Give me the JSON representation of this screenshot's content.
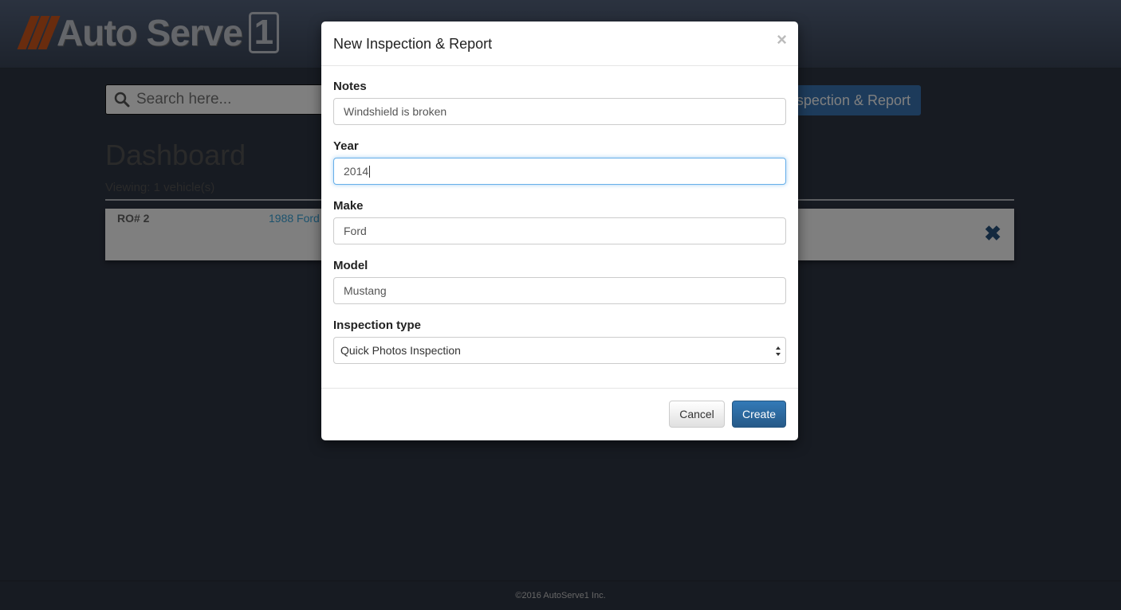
{
  "app": {
    "logo_text": "Auto Serve",
    "logo_number": "1"
  },
  "search": {
    "placeholder": "Search here..."
  },
  "header": {
    "new_report_label": "New Inspection & Report"
  },
  "dashboard": {
    "title": "Dashboard",
    "viewing_text": "Viewing: 1 vehicle(s)",
    "vehicles": [
      {
        "ro": "RO# 2",
        "name": "1988 Ford"
      }
    ]
  },
  "footer": {
    "text": "©2016 AutoServe1 Inc."
  },
  "modal": {
    "title": "New Inspection & Report",
    "close_symbol": "×",
    "fields": {
      "notes": {
        "label": "Notes",
        "value": "Windshield is broken"
      },
      "year": {
        "label": "Year",
        "value": "2014"
      },
      "make": {
        "label": "Make",
        "value": "Ford"
      },
      "model": {
        "label": "Model",
        "value": "Mustang"
      },
      "inspection_type": {
        "label": "Inspection type",
        "selected": "Quick Photos Inspection"
      }
    },
    "buttons": {
      "cancel": "Cancel",
      "create": "Create"
    }
  },
  "colors": {
    "accent": "#337ab7",
    "link": "#3aa6dc",
    "logo_orange": "#d2581c"
  }
}
